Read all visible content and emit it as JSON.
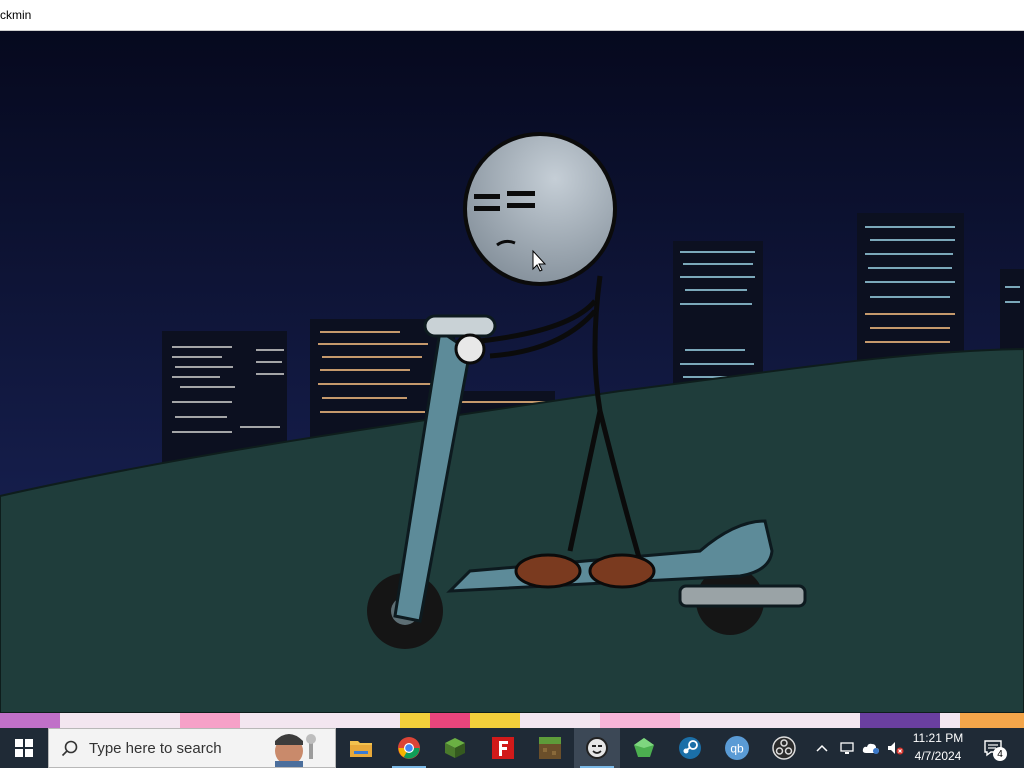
{
  "window": {
    "title": "ckmin"
  },
  "taskbar": {
    "search_placeholder": "Type here to search",
    "clock": {
      "time": "11:21 PM",
      "date": "4/7/2024"
    },
    "notification_count": "4",
    "pinned": [
      {
        "name": "file-explorer",
        "label": "File Explorer",
        "color": "#f2c14e"
      },
      {
        "name": "chrome",
        "label": "Google Chrome",
        "color": "#db4437"
      },
      {
        "name": "minecraft",
        "label": "Minecraft",
        "color": "#5a8a3a"
      },
      {
        "name": "flashpoint",
        "label": "F",
        "color": "#d11a1a"
      },
      {
        "name": "grass-block",
        "label": "Minecraft Launcher",
        "color": "#6b4f2a"
      },
      {
        "name": "henry-stickmin",
        "label": "Henry Stickmin",
        "color": "#cfcfcf"
      },
      {
        "name": "gem-app",
        "label": "Gem",
        "color": "#4caf50"
      },
      {
        "name": "steam",
        "label": "Steam",
        "color": "#1b6fa8"
      },
      {
        "name": "qbittorrent",
        "label": "qb",
        "color": "#5a9bd5"
      },
      {
        "name": "obs",
        "label": "OBS",
        "color": "#2b2b2b"
      }
    ]
  },
  "colors": {
    "sky_top": "#06091e",
    "sky_bottom": "#1c2760",
    "hill": "#1f3d3b",
    "hill_dark": "#183230",
    "scooter": "#5d8b99",
    "head": "#9aa6b0",
    "taskbar": "#1f2a36"
  }
}
